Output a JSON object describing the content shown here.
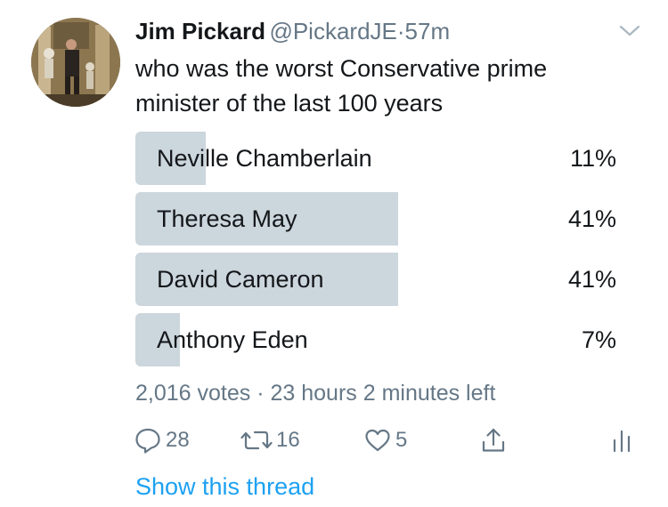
{
  "tweet": {
    "author_name": "Jim Pickard",
    "handle": "@PickardJE",
    "separator": "·",
    "time": "57m",
    "text": "who was the worst Conservative prime minister of the last 100 years"
  },
  "poll": {
    "options": [
      {
        "label": "Neville Chamberlain",
        "percent_text": "11%",
        "percent": 11
      },
      {
        "label": "Theresa May",
        "percent_text": "41%",
        "percent": 41
      },
      {
        "label": "David Cameron",
        "percent_text": "41%",
        "percent": 41
      },
      {
        "label": "Anthony Eden",
        "percent_text": "7%",
        "percent": 7
      }
    ],
    "meta": "2,016 votes · 23 hours 2 minutes left"
  },
  "actions": {
    "replies": "28",
    "retweets": "16",
    "likes": "5"
  },
  "links": {
    "show_thread": "Show this thread"
  },
  "icons": [
    "avatar-image",
    "chevron-down-icon",
    "reply-icon",
    "retweet-icon",
    "like-icon",
    "share-icon",
    "analytics-icon"
  ],
  "colors": {
    "bar": "#ccd6dd",
    "muted": "#657786",
    "link": "#1da1f2",
    "text": "#14171a"
  }
}
